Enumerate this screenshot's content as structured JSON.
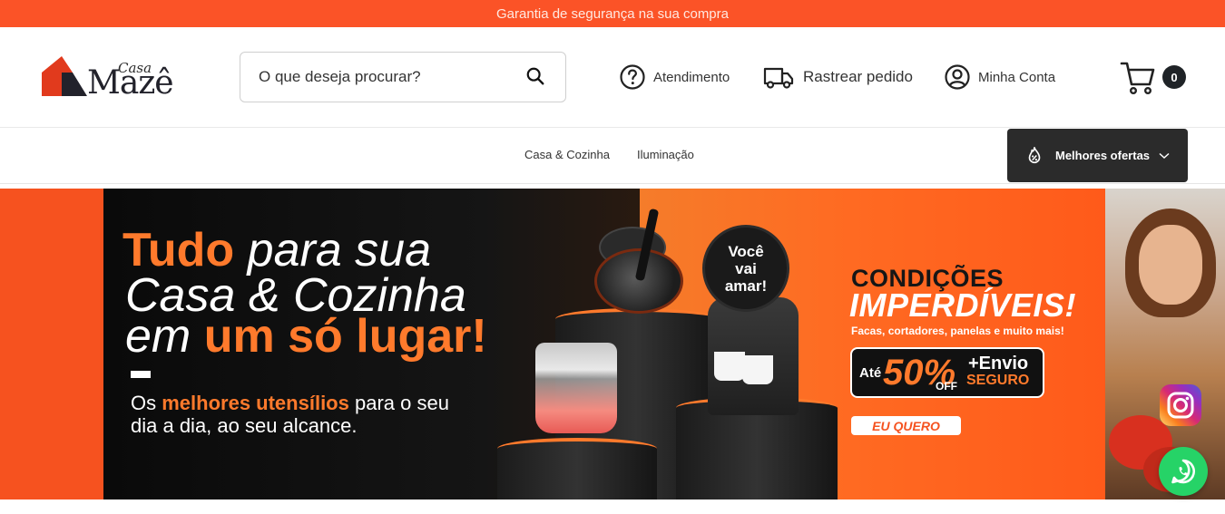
{
  "topbar": {
    "text": "Garantia de segurança na sua compra"
  },
  "logo": {
    "casa": "Casa",
    "maze": "Mazê"
  },
  "search": {
    "placeholder": "O que deseja procurar?"
  },
  "header_links": {
    "atendimento": "Atendimento",
    "rastrear": "Rastrear pedido",
    "conta": "Minha Conta"
  },
  "cart": {
    "count": "0"
  },
  "nav": {
    "items": [
      "Casa & Cozinha",
      "Iluminação"
    ],
    "offers": "Melhores ofertas"
  },
  "banner": {
    "line1_bold": "Tudo",
    "line1_rest": " para sua",
    "line2": "Casa & Cozinha",
    "line3_italic": "em ",
    "line3_bold": "um só lugar!",
    "sub1_pre": "Os ",
    "sub1_bold": "melhores utensílios",
    "sub1_post": " para o seu",
    "sub2": "dia a dia, ao seu alcance.",
    "badge": [
      "Você",
      "vai",
      "amar!"
    ],
    "condicoes": "CONDIÇÕES",
    "imperdiveis": "IMPERDÍVEIS!",
    "facas": "Facas, cortadores, panelas e muito mais!",
    "ate": "Até",
    "percent": "50%",
    "off": "OFF",
    "envio": "+Envio",
    "seguro": "SEGURO",
    "cta": "EU QUERO"
  },
  "colors": {
    "brand_orange": "#fb5327",
    "accent_orange": "#ff7a2c",
    "dark": "#2b2b2b",
    "whatsapp_green": "#26d367"
  }
}
